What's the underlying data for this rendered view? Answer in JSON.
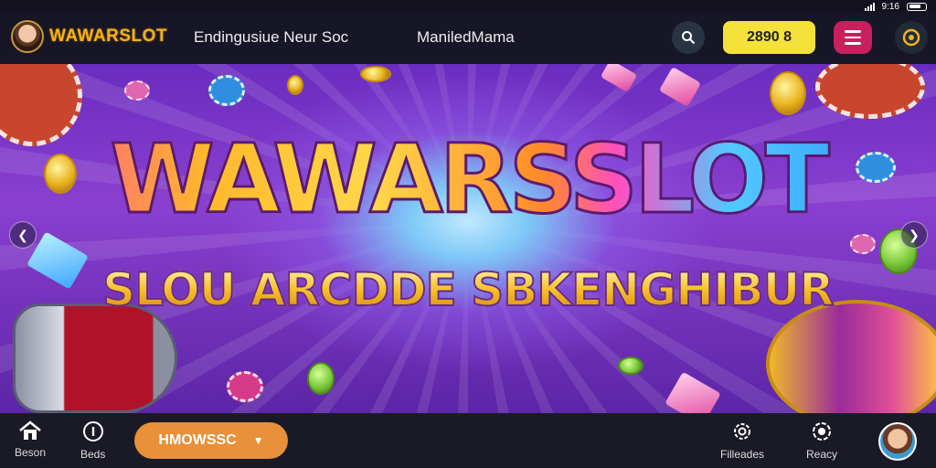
{
  "status_bar": {
    "time": "9:16"
  },
  "header": {
    "logo_text": "WAWARSLOT",
    "nav_links": [
      "Endingusiue Neur Soc",
      "ManiledMama"
    ],
    "balance": "2890 8"
  },
  "banner": {
    "headline": "WAWARSSLOT",
    "subline": "SLOU ARCDDE SBKENGHIBUR"
  },
  "bottom_nav": {
    "items": [
      {
        "label": "Beson",
        "icon": "home-icon"
      },
      {
        "label": "Beds",
        "icon": "info-icon"
      }
    ],
    "pill_label": "HMOWSSC",
    "right_items": [
      {
        "label": "Filleades",
        "icon": "gear-icon"
      },
      {
        "label": "Reacy",
        "icon": "settings-icon"
      }
    ]
  },
  "colors": {
    "accent_gold": "#f3b21a",
    "balance_bg": "#f4e13a",
    "menu_bg": "#c8205c",
    "pill_bg": "#e8903a"
  }
}
